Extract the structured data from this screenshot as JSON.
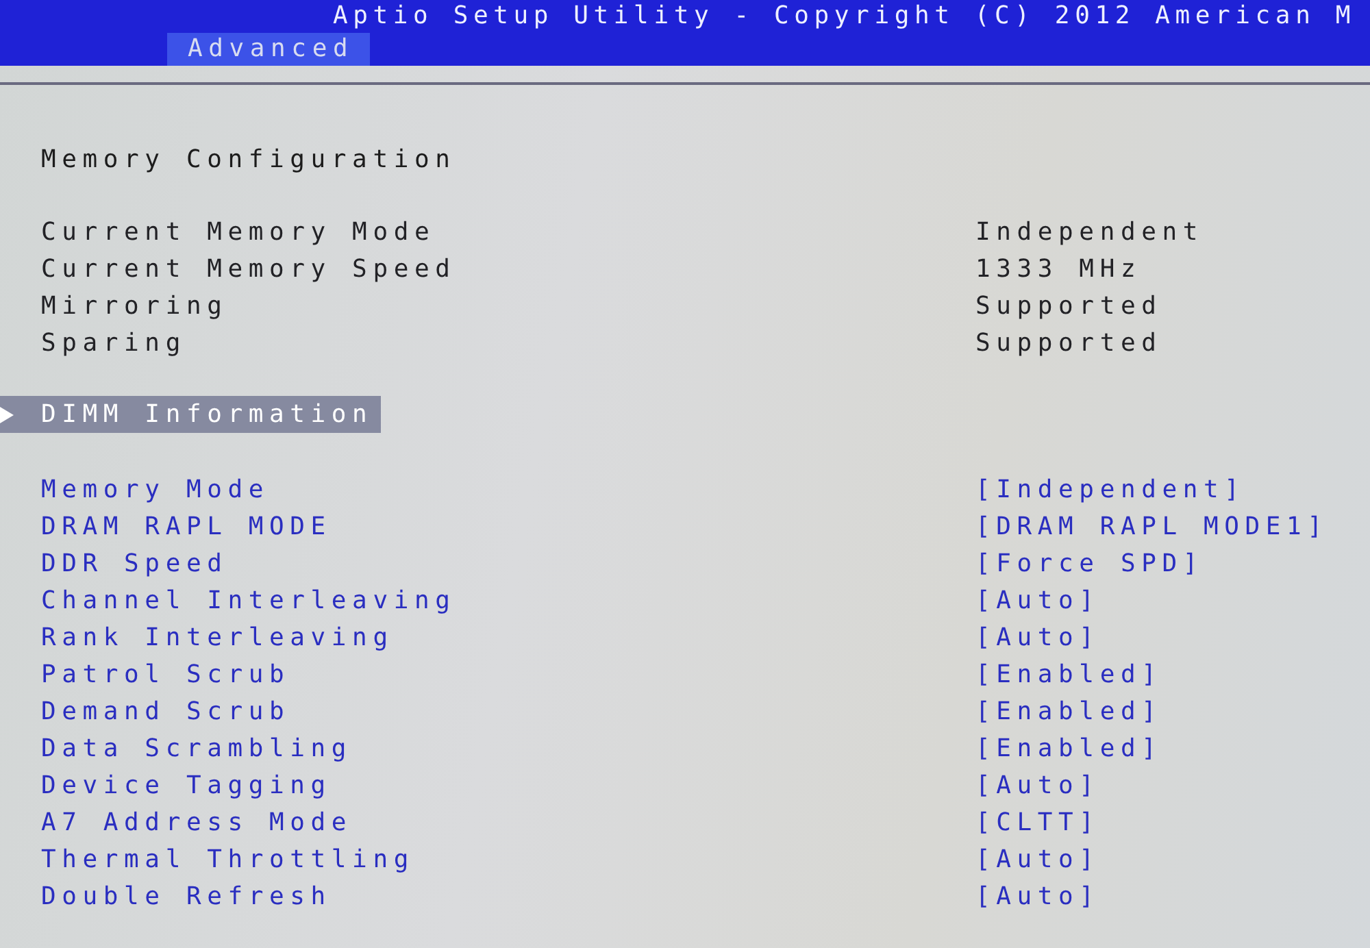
{
  "header": {
    "title": "Aptio Setup Utility - Copyright (C) 2012 American M"
  },
  "tabs": [
    {
      "label": "Advanced",
      "selected": true
    }
  ],
  "section_title": "Memory Configuration",
  "info": [
    {
      "label": "Current Memory Mode",
      "value": "Independent"
    },
    {
      "label": "Current Memory Speed",
      "value": "1333 MHz"
    },
    {
      "label": "Mirroring",
      "value": "Supported"
    },
    {
      "label": "Sparing",
      "value": "Supported"
    }
  ],
  "submenus": [
    {
      "label": "DIMM Information",
      "selected": true
    }
  ],
  "settings": [
    {
      "label": "Memory Mode",
      "value": "[Independent]",
      "selected": false
    },
    {
      "label": "DRAM RAPL MODE",
      "value": "[DRAM RAPL MODE1]",
      "selected": false
    },
    {
      "label": "DDR Speed",
      "value": "[Force SPD]",
      "selected": false
    },
    {
      "label": "Channel Interleaving",
      "value": "[Auto]",
      "selected": false
    },
    {
      "label": "Rank Interleaving",
      "value": "[Auto]",
      "selected": false
    },
    {
      "label": "Patrol Scrub",
      "value": "[Enabled]",
      "selected": false
    },
    {
      "label": "Demand Scrub",
      "value": "[Enabled]",
      "selected": false
    },
    {
      "label": "Data Scrambling",
      "value": "[Enabled]",
      "selected": false
    },
    {
      "label": "Device Tagging",
      "value": "[Auto]",
      "selected": false
    },
    {
      "label": "A7 Address Mode",
      "value": "[CLTT]",
      "selected": false
    },
    {
      "label": "Thermal Throttling",
      "value": "[Auto]",
      "selected": false
    },
    {
      "label": "Double Refresh",
      "value": "[Auto]",
      "selected": false
    }
  ]
}
